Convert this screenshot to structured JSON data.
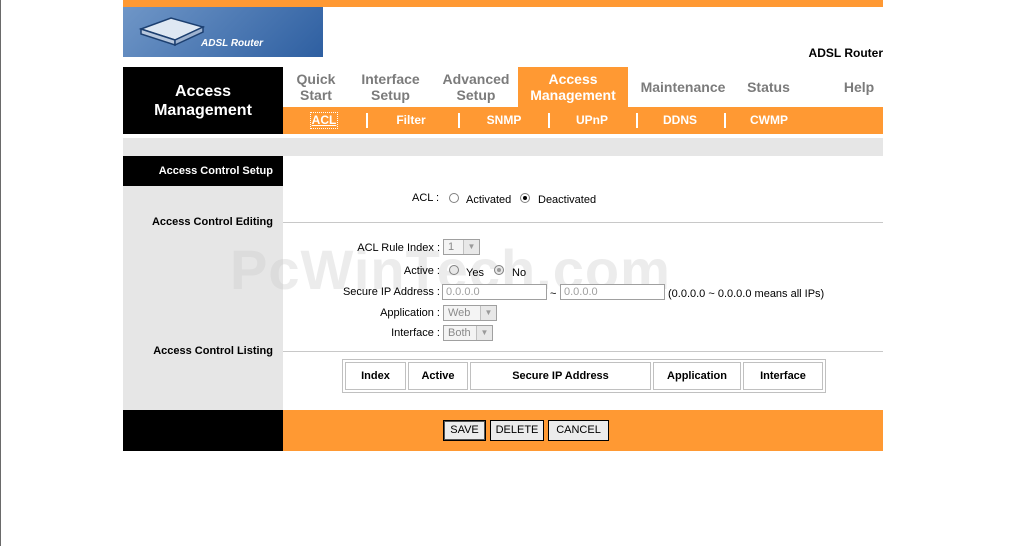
{
  "header": {
    "logo_text": "ADSL Router",
    "product_name": "ADSL Router"
  },
  "section_title_line1": "Access",
  "section_title_line2": "Management",
  "nav": [
    {
      "line1": "Quick",
      "line2": "Start"
    },
    {
      "line1": "Interface",
      "line2": "Setup"
    },
    {
      "line1": "Advanced",
      "line2": "Setup"
    },
    {
      "line1": "Access",
      "line2": "Management",
      "active": true
    },
    {
      "line1": "Maintenance",
      "line2": ""
    },
    {
      "line1": "Status",
      "line2": ""
    },
    {
      "line1": "Help",
      "line2": ""
    }
  ],
  "subnav": [
    "ACL",
    "Filter",
    "SNMP",
    "UPnP",
    "DDNS",
    "CWMP"
  ],
  "sections": {
    "setup": "Access Control Setup",
    "editing": "Access Control Editing",
    "listing": "Access Control Listing"
  },
  "acl": {
    "label": "ACL :",
    "activated": "Activated",
    "deactivated": "Deactivated",
    "selected": "deactivated"
  },
  "editing": {
    "rule_index_label": "ACL Rule Index :",
    "rule_index_value": "1",
    "active_label": "Active :",
    "active_yes": "Yes",
    "active_no": "No",
    "secure_ip_label": "Secure IP Address :",
    "ip_start": "0.0.0.0",
    "ip_sep": "~",
    "ip_end": "0.0.0.0",
    "ip_hint": "(0.0.0.0 ~ 0.0.0.0 means all IPs)",
    "application_label": "Application :",
    "application_value": "Web",
    "interface_label": "Interface :",
    "interface_value": "Both"
  },
  "table": {
    "columns": [
      "Index",
      "Active",
      "Secure IP Address",
      "Application",
      "Interface"
    ]
  },
  "buttons": {
    "save": "SAVE",
    "delete": "DELETE",
    "cancel": "CANCEL"
  },
  "watermark": "PcWinTech.com",
  "colors": {
    "accent": "#ff9933",
    "dark": "#000000",
    "panel": "#e6e6e6"
  }
}
